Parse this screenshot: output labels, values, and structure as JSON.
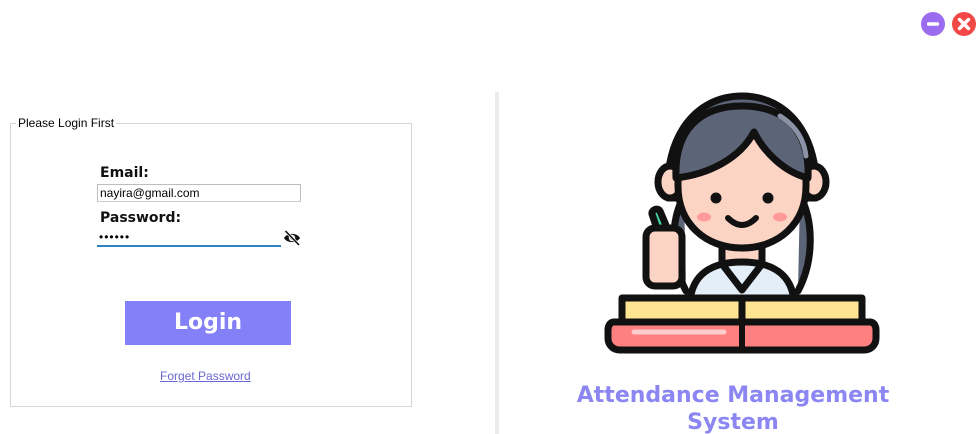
{
  "window_controls": {
    "minimize_icon": "minus-circle-icon",
    "close_icon": "x-circle-icon",
    "minimize_color": "#9b6cf0",
    "close_color": "#f44747"
  },
  "login_panel": {
    "group_title": "Please Login First",
    "email_label": "Email:",
    "email_value": "nayira@gmail.com",
    "password_label": "Password:",
    "password_masked": "••••••",
    "eye_icon": "eye-slash-icon",
    "login_label": "Login",
    "forget_password_label": "Forget Password"
  },
  "branding": {
    "app_title_line1": "Attendance Management",
    "app_title_line2": "System",
    "accent_color": "#8480f8",
    "illustration": "girl-studying-with-book-icon"
  }
}
